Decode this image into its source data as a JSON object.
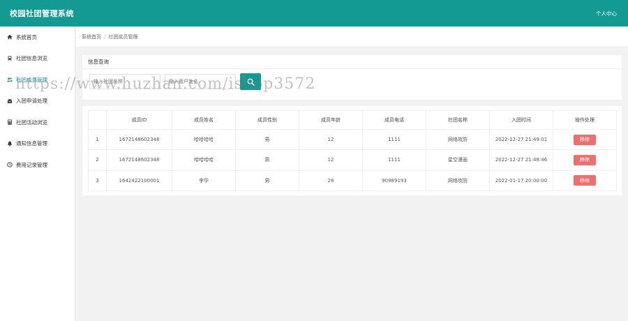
{
  "app": {
    "title": "校园社团管理系统",
    "user_menu": "个人中心"
  },
  "sidebar": {
    "items": [
      {
        "label": "系统首页",
        "icon": "home-icon",
        "active": false
      },
      {
        "label": "社团信息浏览",
        "icon": "train-icon",
        "active": false
      },
      {
        "label": "社团成员管理",
        "icon": "users-icon",
        "active": true
      },
      {
        "label": "入团申请处理",
        "icon": "inbox-icon",
        "active": false
      },
      {
        "label": "社团活动浏览",
        "icon": "calculator-icon",
        "active": false
      },
      {
        "label": "通知信息管理",
        "icon": "bell-icon",
        "active": false
      },
      {
        "label": "费用记录管理",
        "icon": "clock-icon",
        "active": false
      }
    ]
  },
  "breadcrumb": {
    "home": "系统首页",
    "current": "社团成员管理"
  },
  "query": {
    "title": "信息查询",
    "name_placeholder": "输入社团名称",
    "phone_placeholder": "输入用户姓名",
    "search_icon": "search-icon"
  },
  "table": {
    "columns": [
      "",
      "成员ID",
      "成员姓名",
      "成员性别",
      "成员年龄",
      "成员电话",
      "社团名称",
      "入团时间",
      "操作处理"
    ],
    "rows": [
      {
        "index": "1",
        "id": "1672148602348",
        "name": "哈哈哈哈",
        "gender": "男",
        "age": "12",
        "phone": "1111",
        "club": "网络攻防",
        "joined": "2022-12-27 21:49:01",
        "action": "移除"
      },
      {
        "index": "2",
        "id": "1672148602348",
        "name": "哈哈哈哈",
        "gender": "男",
        "age": "12",
        "phone": "1111",
        "club": "星空漫画",
        "joined": "2022-12-27 21:48:46",
        "action": "移除"
      },
      {
        "index": "3",
        "id": "1642422100001",
        "name": "李华",
        "gender": "男",
        "age": "28",
        "phone": "90989193",
        "club": "网络攻防",
        "joined": "2022-01-17 20:00:00",
        "action": "移除"
      }
    ]
  },
  "watermark": "https://www.huzhan.com/ishop3572",
  "colors": {
    "primary": "#139a93",
    "danger": "#ef6f6f"
  }
}
